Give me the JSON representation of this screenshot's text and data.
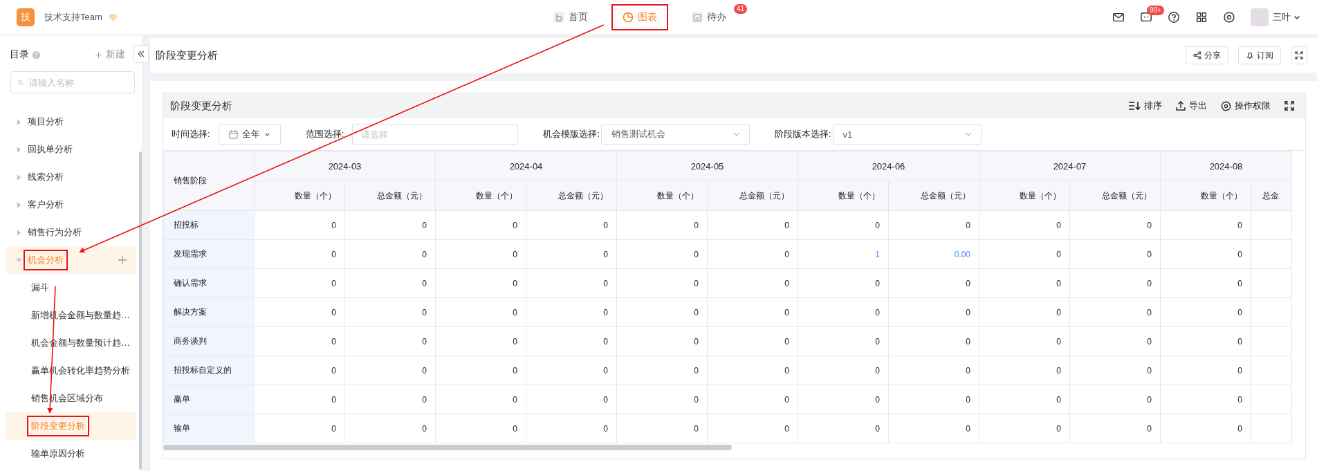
{
  "app": {
    "logo": "技",
    "team": "技术支持Team"
  },
  "nav": [
    {
      "label": "首页",
      "kind": "home",
      "selected": false,
      "annotated": false
    },
    {
      "label": "图表",
      "kind": "chart",
      "selected": true,
      "annotated": true
    },
    {
      "label": "待办",
      "kind": "todo",
      "selected": false,
      "annotated": false,
      "badge": "41"
    }
  ],
  "header_tools": {
    "chat_badge": "99+",
    "user": "三叶"
  },
  "sidebar": {
    "title": "目录",
    "new_label": "新建",
    "search": {
      "placeholder": "请输入名称"
    },
    "items": [
      {
        "label": "项目分析",
        "expanded": false,
        "selected": false,
        "annotated": false
      },
      {
        "label": "回执单分析",
        "expanded": false,
        "selected": false,
        "annotated": false
      },
      {
        "label": "线索分析",
        "expanded": false,
        "selected": false,
        "annotated": false
      },
      {
        "label": "客户分析",
        "expanded": false,
        "selected": false,
        "annotated": false
      },
      {
        "label": "销售行为分析",
        "expanded": false,
        "selected": false,
        "annotated": false
      },
      {
        "label": "机会分析",
        "expanded": true,
        "selected": true,
        "annotated": true,
        "children": [
          {
            "label": "漏斗",
            "selected": false,
            "annotated": false
          },
          {
            "label": "新增机会金额与数量趋…",
            "selected": false,
            "annotated": false
          },
          {
            "label": "机会金额与数量预计趋…",
            "selected": false,
            "annotated": false
          },
          {
            "label": "赢单机会转化率趋势分析",
            "selected": false,
            "annotated": false
          },
          {
            "label": "销售机会区域分布",
            "selected": false,
            "annotated": false
          },
          {
            "label": "阶段变更分析",
            "selected": true,
            "annotated": true
          },
          {
            "label": "输单原因分析",
            "selected": false,
            "annotated": false
          }
        ]
      }
    ]
  },
  "page": {
    "title": "阶段变更分析",
    "buttons": [
      {
        "label": "分享",
        "kind": "share"
      },
      {
        "label": "订阅",
        "kind": "bell"
      }
    ]
  },
  "card": {
    "title": "阶段变更分析",
    "tools": [
      {
        "label": "排序",
        "kind": "sort"
      },
      {
        "label": "导出",
        "kind": "export"
      },
      {
        "label": "操作权限",
        "kind": "gear"
      }
    ],
    "filters": [
      {
        "label": "时间选择:",
        "kind": "date",
        "value": "全年"
      },
      {
        "label": "范围选择:",
        "kind": "input",
        "placeholder": "请选择"
      },
      {
        "label": "机会模版选择:",
        "kind": "select",
        "value": "销售测试机会"
      },
      {
        "label": "阶段版本选择:",
        "kind": "select",
        "value": "v1"
      }
    ]
  },
  "table": {
    "stage_header": "销售阶段",
    "months": [
      "2024-03",
      "2024-04",
      "2024-05",
      "2024-06",
      "2024-07",
      "2024-08"
    ],
    "subheaders": [
      "数量（个）",
      "总金额（元）",
      "数量（个）",
      "总金额（元）",
      "数量（个）",
      "总金额（元）",
      "数量（个）",
      "总金额（元）",
      "数量（个）",
      "总金额（元）",
      "数量（个）",
      "总金"
    ],
    "rows": [
      {
        "stage": "招投标",
        "cells": [
          {
            "value": "0",
            "link": false
          },
          {
            "value": "0",
            "link": false
          },
          {
            "value": "0",
            "link": false
          },
          {
            "value": "0",
            "link": false
          },
          {
            "value": "0",
            "link": false
          },
          {
            "value": "0",
            "link": false
          },
          {
            "value": "0",
            "link": false
          },
          {
            "value": "0",
            "link": false
          },
          {
            "value": "0",
            "link": false
          },
          {
            "value": "0",
            "link": false
          },
          {
            "value": "0",
            "link": false
          }
        ]
      },
      {
        "stage": "发现需求",
        "cells": [
          {
            "value": "0",
            "link": false
          },
          {
            "value": "0",
            "link": false
          },
          {
            "value": "0",
            "link": false
          },
          {
            "value": "0",
            "link": false
          },
          {
            "value": "0",
            "link": false
          },
          {
            "value": "0",
            "link": false
          },
          {
            "value": "1",
            "link": true
          },
          {
            "value": "0.00",
            "link": true
          },
          {
            "value": "0",
            "link": false
          },
          {
            "value": "0",
            "link": false
          },
          {
            "value": "0",
            "link": false
          }
        ]
      },
      {
        "stage": "确认需求",
        "cells": [
          {
            "value": "0",
            "link": false
          },
          {
            "value": "0",
            "link": false
          },
          {
            "value": "0",
            "link": false
          },
          {
            "value": "0",
            "link": false
          },
          {
            "value": "0",
            "link": false
          },
          {
            "value": "0",
            "link": false
          },
          {
            "value": "0",
            "link": false
          },
          {
            "value": "0",
            "link": false
          },
          {
            "value": "0",
            "link": false
          },
          {
            "value": "0",
            "link": false
          },
          {
            "value": "0",
            "link": false
          }
        ]
      },
      {
        "stage": "解决方案",
        "cells": [
          {
            "value": "0",
            "link": false
          },
          {
            "value": "0",
            "link": false
          },
          {
            "value": "0",
            "link": false
          },
          {
            "value": "0",
            "link": false
          },
          {
            "value": "0",
            "link": false
          },
          {
            "value": "0",
            "link": false
          },
          {
            "value": "0",
            "link": false
          },
          {
            "value": "0",
            "link": false
          },
          {
            "value": "0",
            "link": false
          },
          {
            "value": "0",
            "link": false
          },
          {
            "value": "0",
            "link": false
          }
        ]
      },
      {
        "stage": "商务谈判",
        "cells": [
          {
            "value": "0",
            "link": false
          },
          {
            "value": "0",
            "link": false
          },
          {
            "value": "0",
            "link": false
          },
          {
            "value": "0",
            "link": false
          },
          {
            "value": "0",
            "link": false
          },
          {
            "value": "0",
            "link": false
          },
          {
            "value": "0",
            "link": false
          },
          {
            "value": "0",
            "link": false
          },
          {
            "value": "0",
            "link": false
          },
          {
            "value": "0",
            "link": false
          },
          {
            "value": "0",
            "link": false
          }
        ]
      },
      {
        "stage": "招投标自定义的",
        "cells": [
          {
            "value": "0",
            "link": false
          },
          {
            "value": "0",
            "link": false
          },
          {
            "value": "0",
            "link": false
          },
          {
            "value": "0",
            "link": false
          },
          {
            "value": "0",
            "link": false
          },
          {
            "value": "0",
            "link": false
          },
          {
            "value": "0",
            "link": false
          },
          {
            "value": "0",
            "link": false
          },
          {
            "value": "0",
            "link": false
          },
          {
            "value": "0",
            "link": false
          },
          {
            "value": "0",
            "link": false
          }
        ]
      },
      {
        "stage": "赢单",
        "cells": [
          {
            "value": "0",
            "link": false
          },
          {
            "value": "0",
            "link": false
          },
          {
            "value": "0",
            "link": false
          },
          {
            "value": "0",
            "link": false
          },
          {
            "value": "0",
            "link": false
          },
          {
            "value": "0",
            "link": false
          },
          {
            "value": "0",
            "link": false
          },
          {
            "value": "0",
            "link": false
          },
          {
            "value": "0",
            "link": false
          },
          {
            "value": "0",
            "link": false
          },
          {
            "value": "0",
            "link": false
          }
        ]
      },
      {
        "stage": "输单",
        "cells": [
          {
            "value": "0",
            "link": false
          },
          {
            "value": "0",
            "link": false
          },
          {
            "value": "0",
            "link": false
          },
          {
            "value": "0",
            "link": false
          },
          {
            "value": "0",
            "link": false
          },
          {
            "value": "0",
            "link": false
          },
          {
            "value": "0",
            "link": false
          },
          {
            "value": "0",
            "link": false
          },
          {
            "value": "0",
            "link": false
          },
          {
            "value": "0",
            "link": false
          },
          {
            "value": "0",
            "link": false
          }
        ]
      }
    ]
  }
}
